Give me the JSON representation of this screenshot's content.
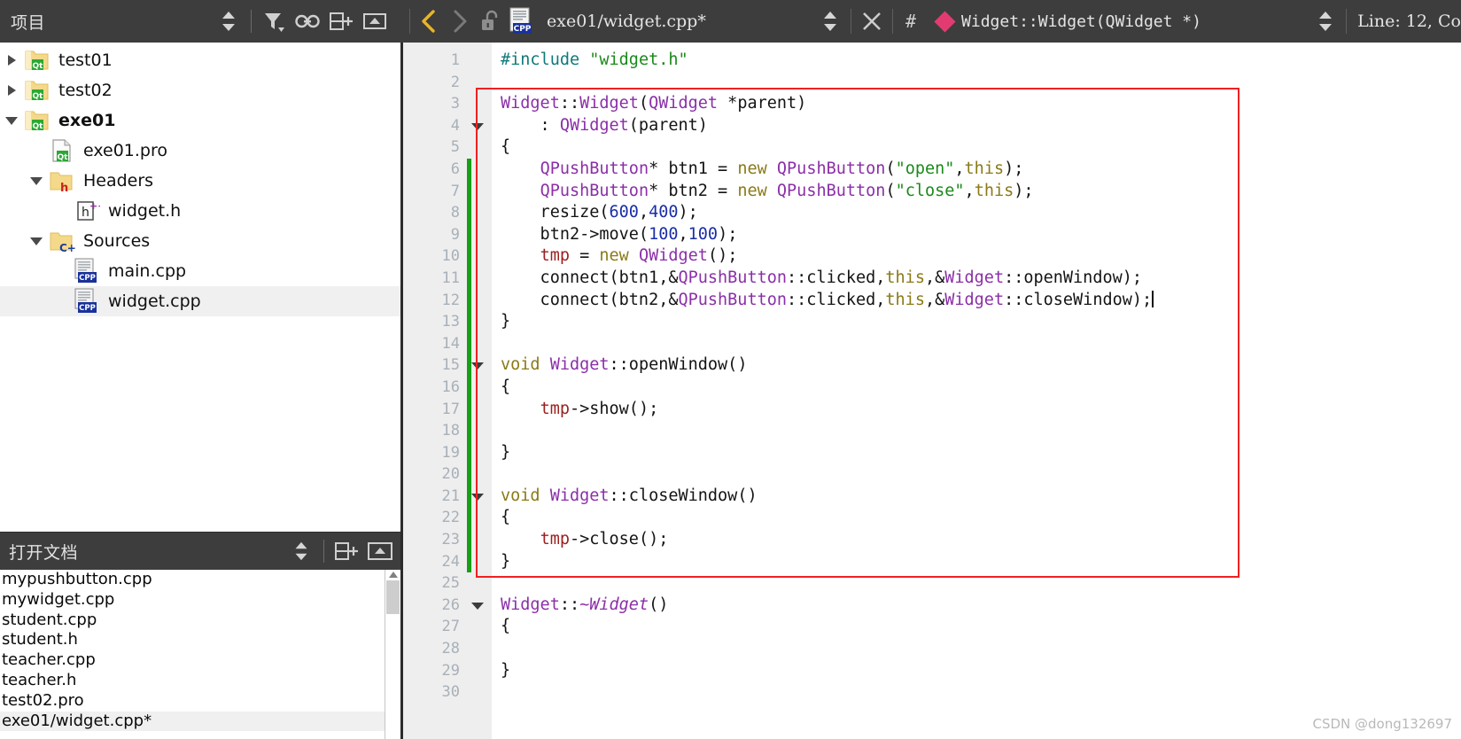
{
  "sidebar": {
    "header": {
      "title": "项目",
      "icons": [
        "sort-arrows-icon",
        "filter-funnel-icon",
        "link-icon",
        "split-add-icon",
        "close-split-icon"
      ]
    },
    "tree": [
      {
        "label": "test01",
        "twist": "right",
        "icon": "qt-folder-icon",
        "indent": 0,
        "bold": false,
        "selected": false
      },
      {
        "label": "test02",
        "twist": "right",
        "icon": "qt-folder-icon",
        "indent": 0,
        "bold": false,
        "selected": false
      },
      {
        "label": "exe01",
        "twist": "down",
        "icon": "qt-folder-icon",
        "indent": 0,
        "bold": true,
        "selected": false
      },
      {
        "label": "exe01.pro",
        "twist": "none",
        "icon": "qt-file-icon",
        "indent": 1,
        "bold": false,
        "selected": false
      },
      {
        "label": "Headers",
        "twist": "down",
        "icon": "h-folder-icon",
        "indent": 1,
        "bold": false,
        "selected": false
      },
      {
        "label": "widget.h",
        "twist": "none",
        "icon": "h-file-icon",
        "indent": 2,
        "bold": false,
        "selected": false
      },
      {
        "label": "Sources",
        "twist": "down",
        "icon": "cpp-folder-icon",
        "indent": 1,
        "bold": false,
        "selected": false
      },
      {
        "label": "main.cpp",
        "twist": "none",
        "icon": "cpp-file-icon",
        "indent": 2,
        "bold": false,
        "selected": false
      },
      {
        "label": "widget.cpp",
        "twist": "none",
        "icon": "cpp-file-icon",
        "indent": 2,
        "bold": false,
        "selected": true
      }
    ]
  },
  "open_documents": {
    "header": {
      "title": "打开文档",
      "icons": [
        "sort-arrows-icon",
        "split-add-icon",
        "close-split-icon"
      ]
    },
    "items": [
      {
        "label": "mypushbutton.cpp",
        "selected": false
      },
      {
        "label": "mywidget.cpp",
        "selected": false
      },
      {
        "label": "student.cpp",
        "selected": false
      },
      {
        "label": "student.h",
        "selected": false
      },
      {
        "label": "teacher.cpp",
        "selected": false
      },
      {
        "label": "teacher.h",
        "selected": false
      },
      {
        "label": "test02.pro",
        "selected": false
      },
      {
        "label": "exe01/widget.cpp*",
        "selected": true
      }
    ]
  },
  "editor_toolbar": {
    "back_icon": "chevron-left-icon",
    "forward_icon": "chevron-right-icon",
    "lock_icon": "unlocked-padlock-icon",
    "file_icon": "cpp-file-icon",
    "file_name": "exe01/widget.cpp*",
    "file_dropdown_icon": "sort-arrows-icon",
    "close_icon": "close-x-icon",
    "hash_symbol": "#",
    "symbol_marker_icon": "pink-diamond-icon",
    "symbol_name": "Widget::Widget(QWidget *)",
    "symbol_dropdown_icon": "sort-arrows-icon",
    "cursor_position": "Line: 12, Co"
  },
  "code": {
    "gutter_start": 1,
    "gutter_end": 30,
    "fold_lines": [
      4,
      15,
      21,
      26
    ],
    "change_bar_lines": [
      6,
      7,
      8,
      9,
      10,
      11,
      12,
      13,
      14,
      15,
      16,
      17,
      18,
      19,
      20,
      21,
      22,
      23,
      24
    ],
    "highlight_box": {
      "from_line": 3,
      "to_line": 24
    },
    "caret_line": 12,
    "lines": [
      {
        "n": 1,
        "tokens": [
          {
            "t": "#include ",
            "c": "pre"
          },
          {
            "t": "\"widget.h\"",
            "c": "str"
          }
        ]
      },
      {
        "n": 2,
        "tokens": []
      },
      {
        "n": 3,
        "tokens": [
          {
            "t": "Widget",
            "c": "type"
          },
          {
            "t": "::",
            "c": "plain"
          },
          {
            "t": "Widget",
            "c": "type"
          },
          {
            "t": "(",
            "c": "plain"
          },
          {
            "t": "QWidget",
            "c": "type"
          },
          {
            "t": " *parent)",
            "c": "plain"
          }
        ]
      },
      {
        "n": 4,
        "tokens": [
          {
            "t": "    : ",
            "c": "plain"
          },
          {
            "t": "QWidget",
            "c": "type"
          },
          {
            "t": "(parent)",
            "c": "plain"
          }
        ]
      },
      {
        "n": 5,
        "tokens": [
          {
            "t": "{",
            "c": "plain"
          }
        ]
      },
      {
        "n": 6,
        "tokens": [
          {
            "t": "    ",
            "c": "plain"
          },
          {
            "t": "QPushButton",
            "c": "type"
          },
          {
            "t": "* btn1 = ",
            "c": "plain"
          },
          {
            "t": "new",
            "c": "kw"
          },
          {
            "t": " ",
            "c": "plain"
          },
          {
            "t": "QPushButton",
            "c": "type"
          },
          {
            "t": "(",
            "c": "plain"
          },
          {
            "t": "\"open\"",
            "c": "str"
          },
          {
            "t": ",",
            "c": "plain"
          },
          {
            "t": "this",
            "c": "kw"
          },
          {
            "t": ");",
            "c": "plain"
          }
        ]
      },
      {
        "n": 7,
        "tokens": [
          {
            "t": "    ",
            "c": "plain"
          },
          {
            "t": "QPushButton",
            "c": "type"
          },
          {
            "t": "* btn2 = ",
            "c": "plain"
          },
          {
            "t": "new",
            "c": "kw"
          },
          {
            "t": " ",
            "c": "plain"
          },
          {
            "t": "QPushButton",
            "c": "type"
          },
          {
            "t": "(",
            "c": "plain"
          },
          {
            "t": "\"close\"",
            "c": "str"
          },
          {
            "t": ",",
            "c": "plain"
          },
          {
            "t": "this",
            "c": "kw"
          },
          {
            "t": ");",
            "c": "plain"
          }
        ]
      },
      {
        "n": 8,
        "tokens": [
          {
            "t": "    resize(",
            "c": "plain"
          },
          {
            "t": "600",
            "c": "num"
          },
          {
            "t": ",",
            "c": "plain"
          },
          {
            "t": "400",
            "c": "num"
          },
          {
            "t": ");",
            "c": "plain"
          }
        ]
      },
      {
        "n": 9,
        "tokens": [
          {
            "t": "    btn2->move(",
            "c": "plain"
          },
          {
            "t": "100",
            "c": "num"
          },
          {
            "t": ",",
            "c": "plain"
          },
          {
            "t": "100",
            "c": "num"
          },
          {
            "t": ");",
            "c": "plain"
          }
        ]
      },
      {
        "n": 10,
        "tokens": [
          {
            "t": "    ",
            "c": "plain"
          },
          {
            "t": "tmp",
            "c": "mem"
          },
          {
            "t": " = ",
            "c": "plain"
          },
          {
            "t": "new",
            "c": "kw"
          },
          {
            "t": " ",
            "c": "plain"
          },
          {
            "t": "QWidget",
            "c": "type"
          },
          {
            "t": "();",
            "c": "plain"
          }
        ]
      },
      {
        "n": 11,
        "tokens": [
          {
            "t": "    connect(btn1,&",
            "c": "plain"
          },
          {
            "t": "QPushButton",
            "c": "type"
          },
          {
            "t": "::clicked,",
            "c": "plain"
          },
          {
            "t": "this",
            "c": "kw"
          },
          {
            "t": ",&",
            "c": "plain"
          },
          {
            "t": "Widget",
            "c": "type"
          },
          {
            "t": "::openWindow);",
            "c": "plain"
          }
        ]
      },
      {
        "n": 12,
        "tokens": [
          {
            "t": "    connect(btn2,&",
            "c": "plain"
          },
          {
            "t": "QPushButton",
            "c": "type"
          },
          {
            "t": "::clicked,",
            "c": "plain"
          },
          {
            "t": "this",
            "c": "kw"
          },
          {
            "t": ",&",
            "c": "plain"
          },
          {
            "t": "Widget",
            "c": "type"
          },
          {
            "t": "::closeWindow);",
            "c": "plain"
          }
        ]
      },
      {
        "n": 13,
        "tokens": [
          {
            "t": "}",
            "c": "plain"
          }
        ]
      },
      {
        "n": 14,
        "tokens": []
      },
      {
        "n": 15,
        "tokens": [
          {
            "t": "void",
            "c": "kw"
          },
          {
            "t": " ",
            "c": "plain"
          },
          {
            "t": "Widget",
            "c": "type"
          },
          {
            "t": "::openWindow()",
            "c": "plain"
          }
        ]
      },
      {
        "n": 16,
        "tokens": [
          {
            "t": "{",
            "c": "plain"
          }
        ]
      },
      {
        "n": 17,
        "tokens": [
          {
            "t": "    ",
            "c": "plain"
          },
          {
            "t": "tmp",
            "c": "mem"
          },
          {
            "t": "->show();",
            "c": "plain"
          }
        ]
      },
      {
        "n": 18,
        "tokens": []
      },
      {
        "n": 19,
        "tokens": [
          {
            "t": "}",
            "c": "plain"
          }
        ]
      },
      {
        "n": 20,
        "tokens": []
      },
      {
        "n": 21,
        "tokens": [
          {
            "t": "void",
            "c": "kw"
          },
          {
            "t": " ",
            "c": "plain"
          },
          {
            "t": "Widget",
            "c": "type"
          },
          {
            "t": "::closeWindow()",
            "c": "plain"
          }
        ]
      },
      {
        "n": 22,
        "tokens": [
          {
            "t": "{",
            "c": "plain"
          }
        ]
      },
      {
        "n": 23,
        "tokens": [
          {
            "t": "    ",
            "c": "plain"
          },
          {
            "t": "tmp",
            "c": "mem"
          },
          {
            "t": "->close();",
            "c": "plain"
          }
        ]
      },
      {
        "n": 24,
        "tokens": [
          {
            "t": "}",
            "c": "plain"
          }
        ]
      },
      {
        "n": 25,
        "tokens": []
      },
      {
        "n": 26,
        "tokens": [
          {
            "t": "Widget",
            "c": "type"
          },
          {
            "t": "::",
            "c": "plain"
          },
          {
            "t": "~Widget",
            "c": "ital"
          },
          {
            "t": "()",
            "c": "plain"
          }
        ]
      },
      {
        "n": 27,
        "tokens": [
          {
            "t": "{",
            "c": "plain"
          }
        ]
      },
      {
        "n": 28,
        "tokens": []
      },
      {
        "n": 29,
        "tokens": [
          {
            "t": "}",
            "c": "plain"
          }
        ]
      },
      {
        "n": 30,
        "tokens": []
      }
    ]
  },
  "watermark": "CSDN @dong132697",
  "colors": {
    "chrome": "#3d3d3d",
    "gutter": "#eeeeee",
    "selection": "#f0f0f0",
    "highlight_box": "#f02020",
    "change_bar": "#16a016",
    "accent_yellow": "#e8b42a",
    "symbol_marker": "#e23b72"
  }
}
